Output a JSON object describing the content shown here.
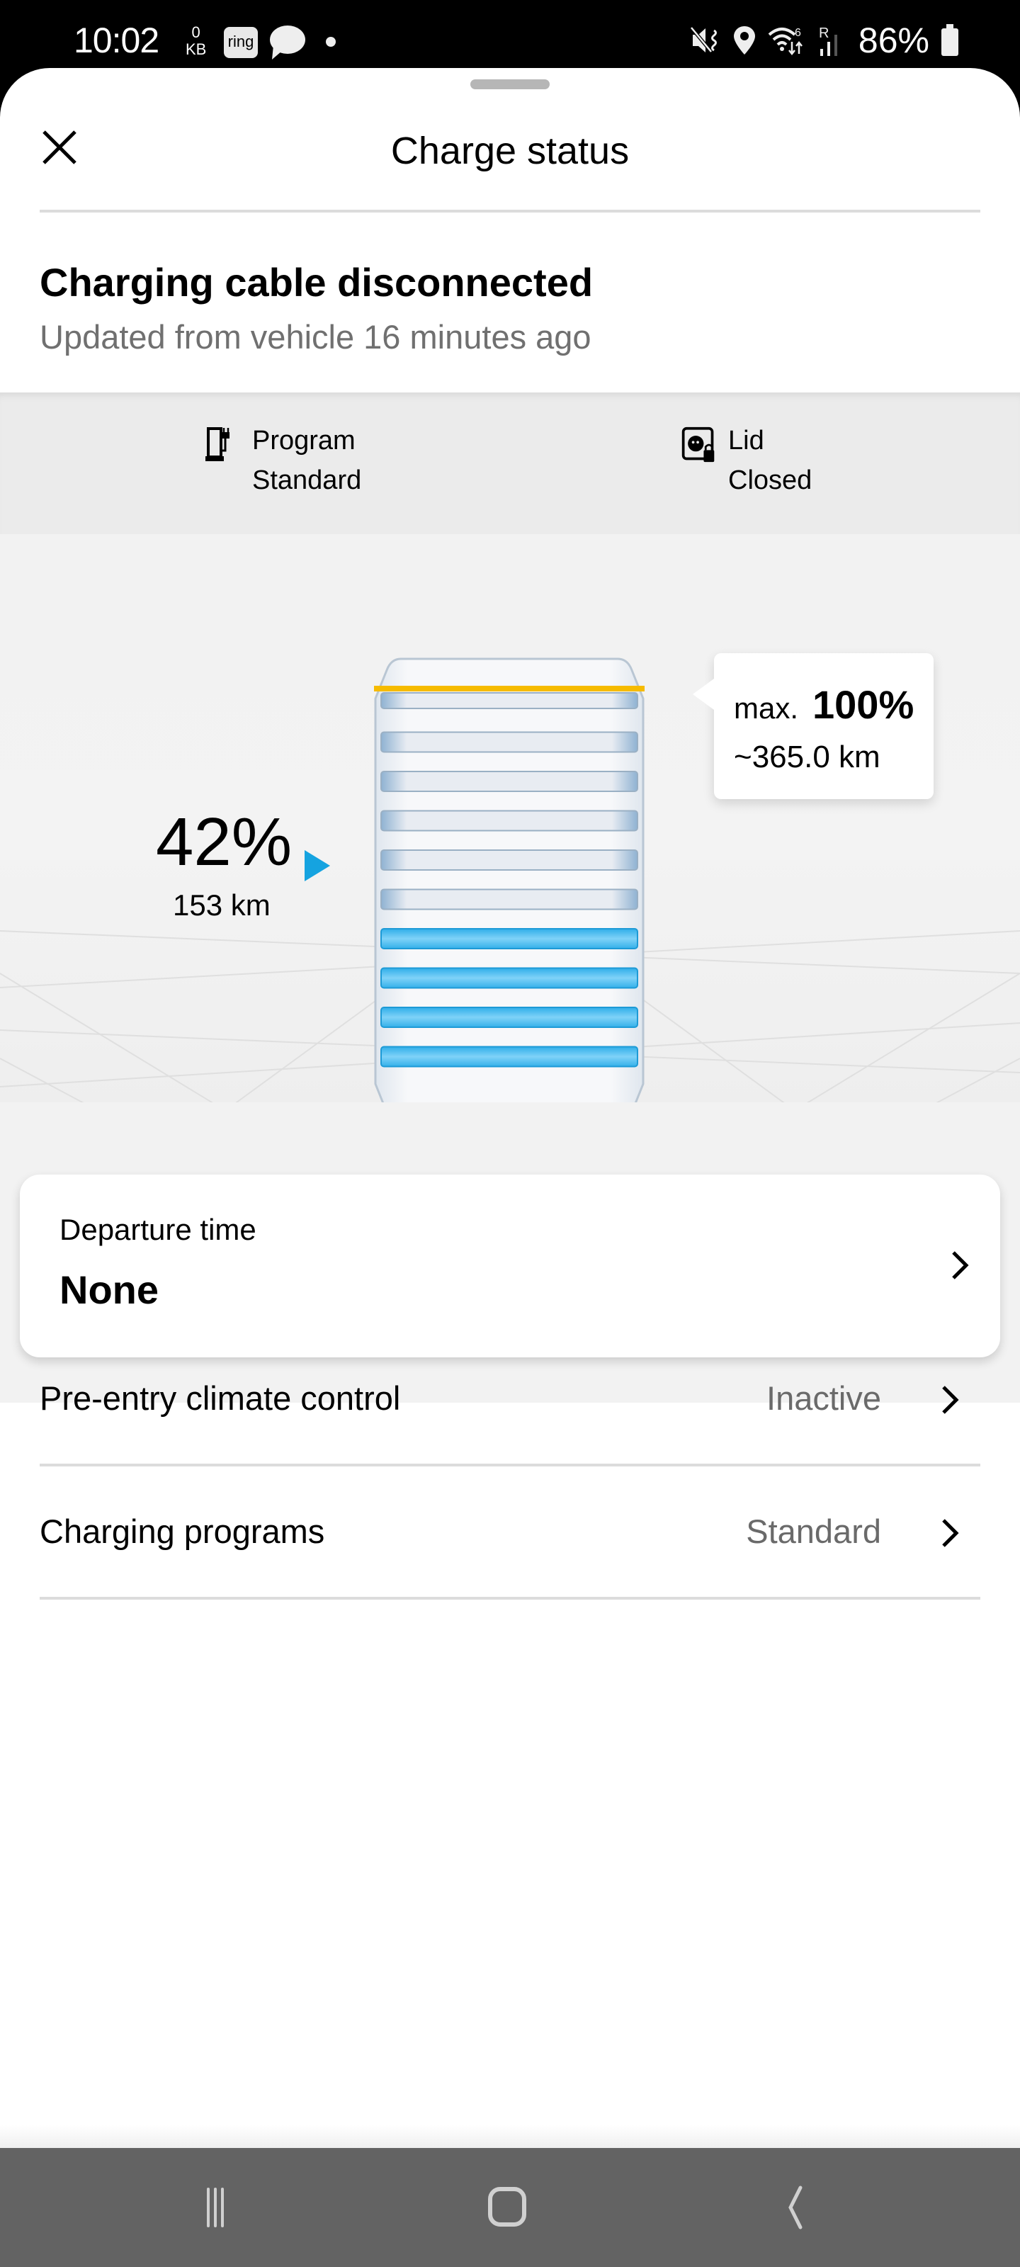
{
  "status_bar": {
    "time": "10:02",
    "data_rate_value": "0",
    "data_rate_unit": "KB",
    "notification_icons": [
      "ring-app-icon",
      "chat-bubble-icon",
      "dot-icon"
    ],
    "ring_label": "ring",
    "system_icons": [
      "mute-vibrate-icon",
      "location-icon",
      "wifi-6-icon",
      "roaming-signal-icon",
      "battery-icon"
    ],
    "roaming_label": "R",
    "battery_percent": "86%"
  },
  "header": {
    "title": "Charge status",
    "close_icon": "close-icon"
  },
  "status": {
    "headline": "Charging cable disconnected",
    "subtitle": "Updated from vehicle 16 minutes ago"
  },
  "info": [
    {
      "icon": "charging-station-icon",
      "label": "Program",
      "value": "Standard"
    },
    {
      "icon": "charge-lid-lock-icon",
      "label": "Lid",
      "value": "Closed"
    }
  ],
  "battery": {
    "state_of_charge_percent": 42,
    "current_label": "42%",
    "current_range": "153 km",
    "max_prefix": "max.",
    "max_label": "100%",
    "max_percent": 100,
    "max_range": "~365.0 km",
    "segments_total": 10,
    "segments_filled": 4,
    "colors": {
      "filled": "#3db8f0",
      "empty": "#a9c4dc",
      "limit_line": "#f6bb00",
      "indicator": "#15a3e0"
    }
  },
  "departure": {
    "label": "Departure time",
    "value": "None"
  },
  "settings": [
    {
      "label": "Pre-entry climate control",
      "value": "Inactive"
    },
    {
      "label": "Charging programs",
      "value": "Standard"
    }
  ],
  "nav_bar": {
    "buttons": [
      "recent-apps-icon",
      "home-icon",
      "back-icon"
    ]
  }
}
